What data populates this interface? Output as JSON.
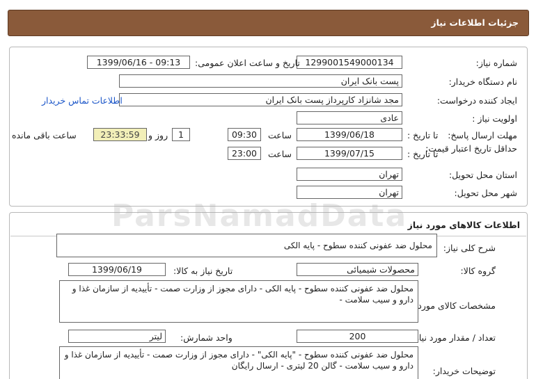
{
  "header": {
    "title": "جزئیات اطلاعات نیاز"
  },
  "need": {
    "number_label": "شماره نیاز:",
    "number": "1299001549000134",
    "announce_label": "تاریخ و ساعت اعلان عمومی:",
    "announce": "1399/06/16 - 09:13",
    "buyer_label": "نام دستگاه خریدار:",
    "buyer": "پست بانک ایران",
    "creator_label": "ایجاد کننده درخواست:",
    "creator": "مجد شانزاد کارپرداز پست بانک ایران",
    "contact_link": "اطلاعات تماس خریدار",
    "priority_label": "اولویت نیاز :",
    "priority": "عادی",
    "deadline_label": "مهلت ارسال پاسخ:",
    "to_date_label": "تا تاریخ :",
    "deadline_date": "1399/06/18",
    "time_label": "ساعت",
    "deadline_time": "09:30",
    "days_value": "1",
    "days_label": "روز و",
    "remaining_time": "23:33:59",
    "remaining_label": "ساعت باقی مانده",
    "validity_label": "حداقل تاریخ اعتبار قیمت:",
    "validity_date": "1399/07/15",
    "validity_time": "23:00",
    "province_label": "استان محل تحویل:",
    "province": "تهران",
    "city_label": "شهر محل تحویل:",
    "city": "تهران"
  },
  "goods": {
    "section_title": "اطلاعات کالاهای مورد نیاز",
    "summary_label": "شرح کلی نیاز:",
    "summary": "محلول ضد عفونی کننده سطوح - پایه الکی",
    "group_label": "گروه کالا:",
    "group": "محصولات شیمیائی",
    "need_date_label": "تاریخ نیاز به کالا:",
    "need_date": "1399/06/19",
    "specs_label": "مشخصات کالای مورد نیاز:",
    "specs": "محلول ضد عفونی کننده سطوح - پایه الکی - دارای مجوز از وزارت صمت - تأییدیه از سازمان غذا و دارو و سیب سلامت -",
    "qty_label": "تعداد / مقدار مورد نیاز:",
    "qty": "200",
    "unit_label": "واحد شمارش:",
    "unit": "لیتر",
    "desc_label": "توضیحات خریدار:",
    "desc": "محلول ضد عفونی کننده سطوح - \"پایه الکی\" - دارای مجوز از وزارت صمت - تأییدیه از سازمان غذا و دارو و سیب سلامت - گالن 20 لیتری - ارسال رایگان"
  },
  "watermark": "ParsNamadData"
}
